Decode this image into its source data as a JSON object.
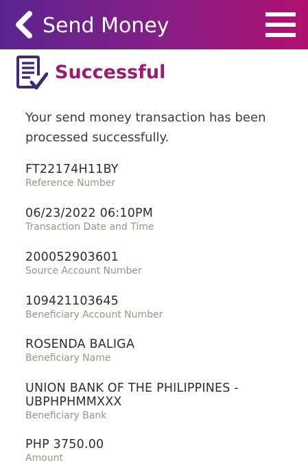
{
  "header": {
    "title": "Send Money",
    "back_icon": "chevron-left-icon",
    "menu_icon": "hamburger-menu-icon",
    "gradient_start": "#5a2590",
    "gradient_end": "#b0106f"
  },
  "status": {
    "icon": "receipt-check-icon",
    "title": "Successful",
    "color": "#9b1b72"
  },
  "message": "Your send money transaction has been processed successfully.",
  "details": [
    {
      "value": "FT22174H11BY",
      "label": "Reference Number"
    },
    {
      "value": "06/23/2022 06:10PM",
      "label": "Transaction Date and Time"
    },
    {
      "value": "200052903601",
      "label": "Source Account Number"
    },
    {
      "value": "109421103645",
      "label": "Beneficiary Account Number"
    },
    {
      "value": "ROSENDA BALIGA",
      "label": "Beneficiary Name"
    },
    {
      "value": "UNION BANK OF THE PHILIPPINES - UBPHPHMMXXX",
      "label": "Beneficiary Bank"
    },
    {
      "value": "PHP 3750.00",
      "label": "Amount"
    }
  ]
}
